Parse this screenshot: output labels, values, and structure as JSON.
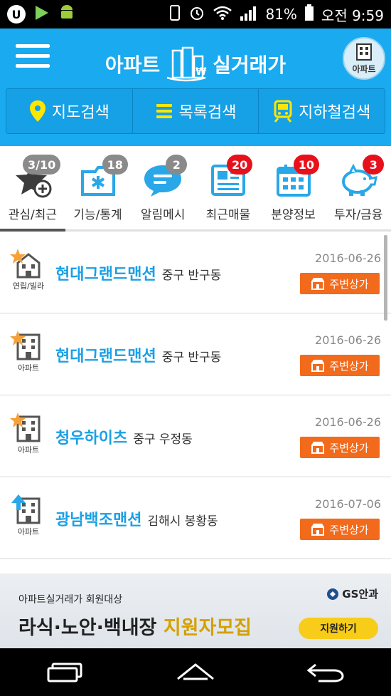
{
  "status_bar": {
    "battery": "81%",
    "time": "오전 9:59"
  },
  "header": {
    "title": "아파트 실거래가",
    "title_left": "아파트",
    "title_right": "실거래가",
    "type_toggle_label": "아파트"
  },
  "search": {
    "map": "지도검색",
    "list": "목록검색",
    "subway": "지하철검색"
  },
  "menu": [
    {
      "label": "관심/최근",
      "badge": "3/10",
      "badge_color": "gray"
    },
    {
      "label": "기능/통계",
      "badge": "18",
      "badge_color": "gray"
    },
    {
      "label": "알림메시",
      "badge": "2",
      "badge_color": "gray"
    },
    {
      "label": "최근매물",
      "badge": "20",
      "badge_color": "red"
    },
    {
      "label": "분양정보",
      "badge": "10",
      "badge_color": "red"
    },
    {
      "label": "투자/금융",
      "badge": "3",
      "badge_color": "red"
    }
  ],
  "items": [
    {
      "type": "연립/빌라",
      "name": "현대그랜드맨션",
      "addr": "중구 반구동",
      "date": "2016-06-26",
      "button": "주변상가",
      "mark": "star"
    },
    {
      "type": "아파트",
      "name": "현대그랜드맨션",
      "addr": "중구 반구동",
      "date": "2016-06-26",
      "button": "주변상가",
      "mark": "star"
    },
    {
      "type": "아파트",
      "name": "청우하이츠",
      "addr": "중구 우정동",
      "date": "2016-06-26",
      "button": "주변상가",
      "mark": "star"
    },
    {
      "type": "아파트",
      "name": "광남백조맨션",
      "addr": "김해시 봉황동",
      "date": "2016-07-06",
      "button": "주변상가",
      "mark": "arrow"
    }
  ],
  "ad": {
    "small": "아파트실거래가 회원대상",
    "big_part1": "라식·노안·백내장",
    "big_part2": "지원자모집",
    "brand": "GS안과",
    "button": "지원하기"
  },
  "colors": {
    "primary": "#1aaaf0",
    "accent": "#f26a1b",
    "badge_red": "#e8111b"
  }
}
